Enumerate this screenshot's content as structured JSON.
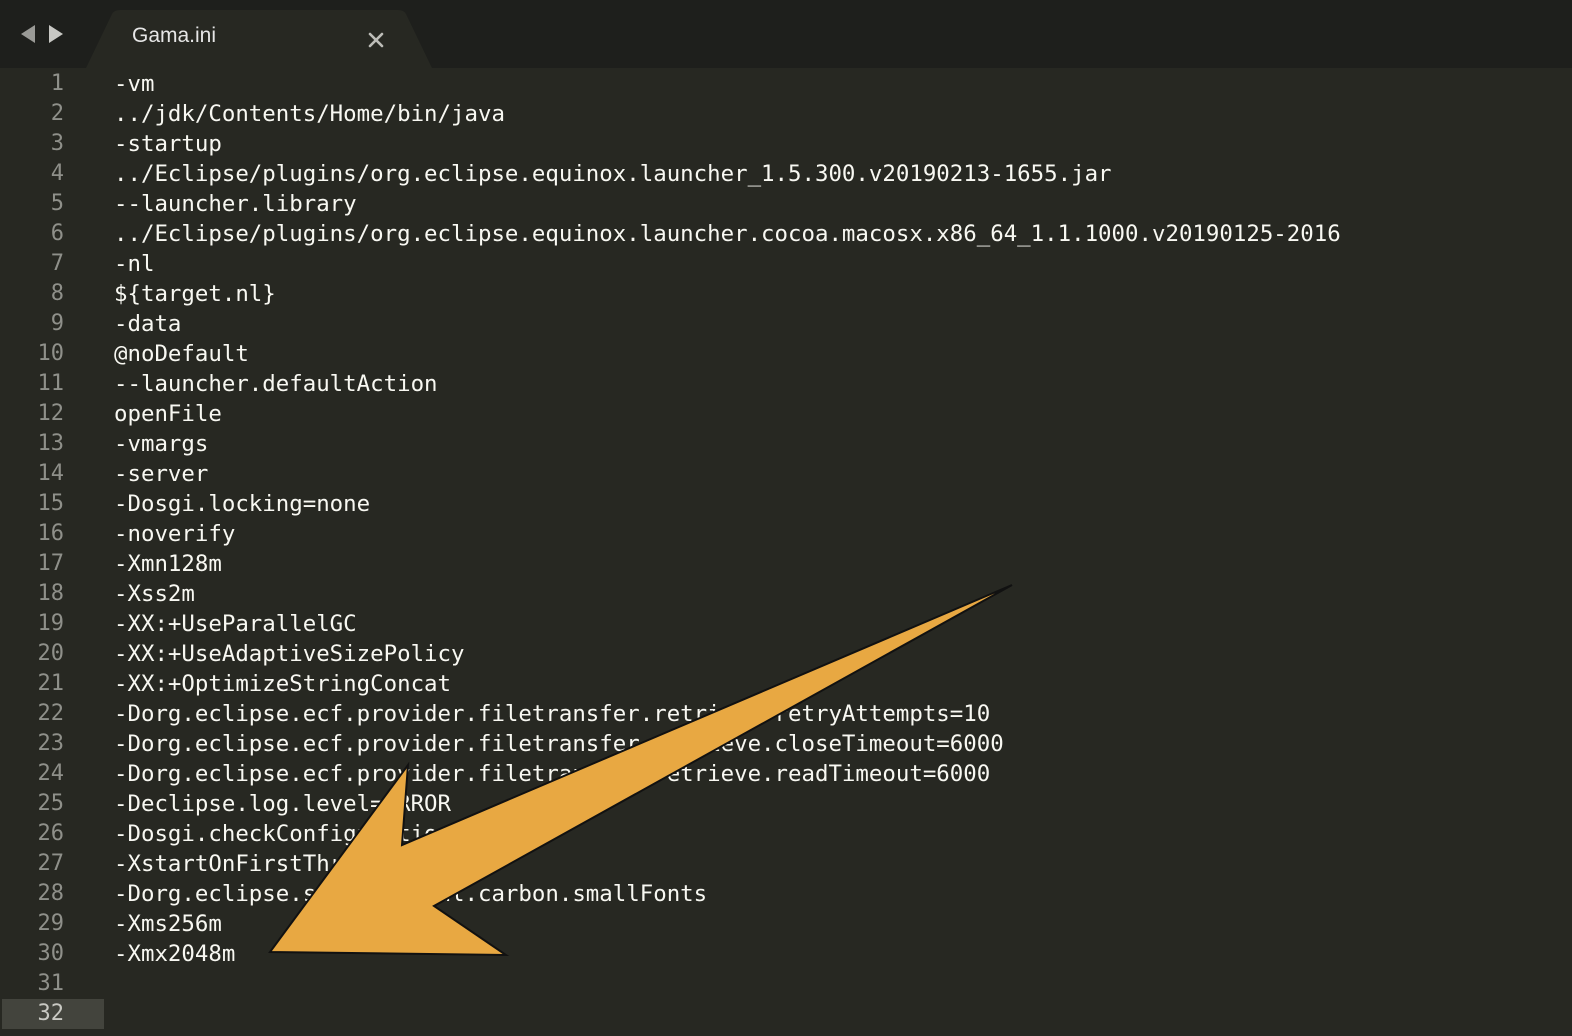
{
  "tabbar": {
    "back_icon": "triangle-left-icon",
    "forward_icon": "triangle-right-icon",
    "tab": {
      "title": "Gama.ini",
      "close_icon": "close-x-icon"
    }
  },
  "editor": {
    "current_line": 32,
    "lines": [
      "-vm",
      "../jdk/Contents/Home/bin/java",
      "-startup",
      "../Eclipse/plugins/org.eclipse.equinox.launcher_1.5.300.v20190213-1655.jar",
      "--launcher.library",
      "../Eclipse/plugins/org.eclipse.equinox.launcher.cocoa.macosx.x86_64_1.1.1000.v20190125-2016",
      "-nl",
      "${target.nl}",
      "-data",
      "@noDefault",
      "--launcher.defaultAction",
      "openFile",
      "-vmargs",
      "-server",
      "-Dosgi.locking=none",
      "-noverify",
      "-Xmn128m",
      "-Xss2m",
      "-XX:+UseParallelGC",
      "-XX:+UseAdaptiveSizePolicy",
      "-XX:+OptimizeStringConcat",
      "-Dorg.eclipse.ecf.provider.filetransfer.retrieve.retryAttempts=10",
      "-Dorg.eclipse.ecf.provider.filetransfer.retrieve.closeTimeout=6000",
      "-Dorg.eclipse.ecf.provider.filetransfer.retrieve.readTimeout=6000",
      "-Declipse.log.level=ERROR",
      "-Dosgi.checkConfiguration=true",
      "-XstartOnFirstThread",
      "-Dorg.eclipse.swt.internal.carbon.smallFonts",
      "-Xms256m",
      "-Xmx2048m",
      "",
      ""
    ]
  },
  "annotation": {
    "icon": "arrow-annotation-icon",
    "fill_color": "#e8a842"
  },
  "colors": {
    "background": "#272822",
    "tabbar": "#1e1f1c",
    "active_tab": "#272822",
    "text": "#f8f8f2",
    "line_number": "#8f908a",
    "current_line": "#43443d"
  }
}
